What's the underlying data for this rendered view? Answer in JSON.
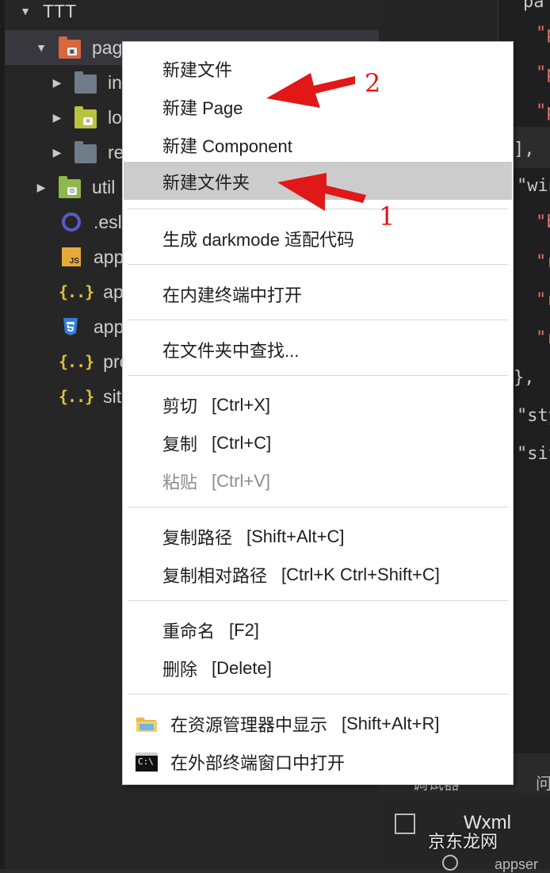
{
  "explorer": {
    "root": "TTT",
    "items": [
      {
        "label": "pages",
        "type": "folder-open",
        "icon": "pages-folder-icon"
      },
      {
        "label": "in",
        "type": "folder",
        "icon": "folder-icon"
      },
      {
        "label": "lo",
        "type": "folder",
        "icon": "logs-folder-icon"
      },
      {
        "label": "re",
        "type": "folder",
        "icon": "folder-icon"
      },
      {
        "label": "util",
        "type": "folder",
        "icon": "utils-folder-icon"
      },
      {
        "label": ".esl",
        "type": "file",
        "icon": "eslint-icon"
      },
      {
        "label": "app",
        "type": "file",
        "icon": "js-icon",
        "icon_text": "JS"
      },
      {
        "label": "app",
        "type": "file",
        "icon": "json-icon",
        "icon_text": "{..}"
      },
      {
        "label": "app",
        "type": "file",
        "icon": "css-icon"
      },
      {
        "label": "pro",
        "type": "file",
        "icon": "json-icon",
        "icon_text": "{..}"
      },
      {
        "label": "site",
        "type": "file",
        "icon": "json-icon",
        "icon_text": "{..}"
      }
    ]
  },
  "editor": {
    "top_fragment": "pa",
    "lines": [
      "\"p",
      "\"p",
      "\"p",
      "],",
      "\"win",
      "\"b",
      "\"r",
      "\"r",
      "\"r",
      "},",
      "\"sty",
      "\"sit"
    ],
    "panel_tab_1": "调试器",
    "panel_tab_2": "问",
    "panel_item": "Wxml",
    "panel_bottom": "appser"
  },
  "context_menu": {
    "groups": [
      {
        "items": [
          {
            "label": "新建文件"
          },
          {
            "label": "新建 Page"
          },
          {
            "label": "新建 Component"
          },
          {
            "label": "新建文件夹",
            "highlighted": true
          }
        ]
      },
      {
        "items": [
          {
            "label": "生成 darkmode 适配代码"
          }
        ]
      },
      {
        "items": [
          {
            "label": "在内建终端中打开"
          }
        ]
      },
      {
        "items": [
          {
            "label": "在文件夹中查找..."
          }
        ]
      },
      {
        "items": [
          {
            "label": "剪切",
            "shortcut": "[Ctrl+X]"
          },
          {
            "label": "复制",
            "shortcut": "[Ctrl+C]"
          },
          {
            "label": "粘贴",
            "shortcut": "[Ctrl+V]",
            "disabled": true
          }
        ]
      },
      {
        "items": [
          {
            "label": "复制路径",
            "shortcut": "[Shift+Alt+C]"
          },
          {
            "label": "复制相对路径",
            "shortcut": "[Ctrl+K Ctrl+Shift+C]"
          }
        ]
      },
      {
        "items": [
          {
            "label": "重命名",
            "shortcut": "[F2]"
          },
          {
            "label": "删除",
            "shortcut": "[Delete]"
          }
        ]
      },
      {
        "items": [
          {
            "label": "在资源管理器中显示",
            "shortcut": "[Shift+Alt+R]",
            "icon": "explorer-folder-icon"
          },
          {
            "label": "在外部终端窗口中打开",
            "icon": "terminal-icon",
            "icon_text": "C:\\"
          }
        ]
      }
    ]
  },
  "annotations": {
    "arrow_1_number": "1",
    "arrow_2_number": "2",
    "arrow_color": "#e01818"
  },
  "watermark": "京东龙网"
}
